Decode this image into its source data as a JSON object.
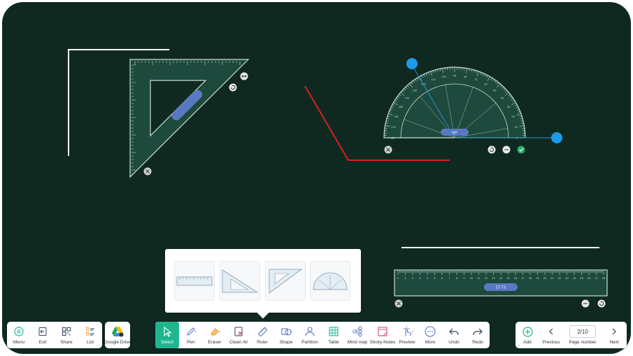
{
  "canvas": {
    "background_color": "#0f2921",
    "stroke_white": "#ffffff",
    "stroke_red": "#d62020",
    "accent_blue": "#1e9be8"
  },
  "tools": {
    "set_square": {
      "rotate_icon": "rotate-icon",
      "close_icon": "close-icon"
    },
    "protractor": {
      "angle_readout": "60°",
      "scale": [
        "0",
        "10",
        "20",
        "30",
        "40",
        "50",
        "60",
        "70",
        "80",
        "90",
        "100",
        "110",
        "120",
        "130",
        "140",
        "150",
        "160",
        "170",
        "180"
      ],
      "confirm_icon": "check-icon"
    },
    "ruler": {
      "readout": "17.73",
      "scale": [
        "0",
        "1",
        "2",
        "3",
        "4",
        "5",
        "6",
        "7",
        "8",
        "9",
        "10",
        "11",
        "12",
        "13",
        "14",
        "15",
        "16",
        "17",
        "18",
        "19",
        "20",
        "21",
        "22",
        "23",
        "24",
        "25",
        "26",
        "27",
        "28"
      ]
    }
  },
  "ruler_popup": {
    "options": [
      "ruler",
      "right-triangle",
      "isosceles-triangle",
      "protractor"
    ]
  },
  "left_toolbar": {
    "items": [
      {
        "label": "Menu",
        "icon": "menu-icon"
      },
      {
        "label": "Exit",
        "icon": "exit-icon"
      },
      {
        "label": "Share",
        "icon": "qr-icon"
      },
      {
        "label": "List",
        "icon": "list-icon"
      }
    ]
  },
  "drive": {
    "label": "Google Drive",
    "icon": "google-drive-icon"
  },
  "main_toolbar": {
    "items": [
      {
        "label": "Select",
        "icon": "cursor-icon",
        "active": true
      },
      {
        "label": "Pen",
        "icon": "pen-icon"
      },
      {
        "label": "Eraser",
        "icon": "eraser-icon"
      },
      {
        "label": "Clean All",
        "icon": "clean-all-icon"
      },
      {
        "label": "Ruler",
        "icon": "ruler-icon"
      },
      {
        "label": "Shape",
        "icon": "shape-icon"
      },
      {
        "label": "Partition",
        "icon": "partition-icon"
      },
      {
        "label": "Table",
        "icon": "table-icon"
      },
      {
        "label": "Mind map",
        "icon": "mind-map-icon"
      },
      {
        "label": "Sticky-Notes",
        "icon": "sticky-note-icon"
      },
      {
        "label": "Preview",
        "icon": "preview-icon"
      },
      {
        "label": "More",
        "icon": "more-icon"
      },
      {
        "label": "Undo",
        "icon": "undo-icon"
      },
      {
        "label": "Redo",
        "icon": "redo-icon"
      }
    ]
  },
  "page_toolbar": {
    "add_label": "Add",
    "previous_label": "Previous",
    "page_number_value": "2/10",
    "page_number_label": "Page number",
    "next_label": "Next"
  }
}
